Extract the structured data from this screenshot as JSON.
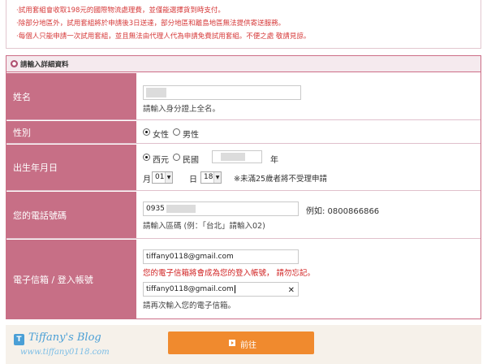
{
  "notice": {
    "lines": [
      "·試用套組會收取198元的國際物流處理費，並僅能選擇貨到時支付。",
      "·除部分地區外，試用套組將於申請後3日送達，部分地區和離島地區無法提供寄送服務。",
      "·每個人只能申請一次試用套組，並且無法由代理人代為申請免費試用套組。不便之處 敬請見諒。"
    ]
  },
  "section": {
    "title": "請輸入詳細資料"
  },
  "name_row": {
    "label": "姓名",
    "hint": "請輸入身分證上全名。"
  },
  "gender_row": {
    "label": "性別",
    "options": [
      "女性",
      "男性"
    ],
    "selected": "女性"
  },
  "birth_row": {
    "label": "出生年月日",
    "era_options": [
      "西元",
      "民國"
    ],
    "era_selected": "西元",
    "year_unit": "年",
    "month_label": "月",
    "month_value": "01",
    "day_label": "日",
    "day_value": "18",
    "age_note": "※未滿25歲者將不受理申請"
  },
  "phone_row": {
    "label": "您的電話號碼",
    "value_prefix": "0935",
    "example_label": "例如: 0800866866",
    "hint": "請輸入區碼 (例：「台北」請輸入02)"
  },
  "email_row": {
    "label": "電子信箱 / 登入帳號",
    "email_value": "tiffany0118@gmail.com",
    "warning": "您的電子信箱將會成為您的登入帳號，  請勿忘記。",
    "confirm_value": "tiffany0118@gmail.com",
    "confirm_hint": "請再次輸入您的電子信箱。"
  },
  "footer": {
    "watermark_title": "Tiffany's Blog",
    "watermark_url": "www.tiffany0118.com",
    "next_label": "前往"
  },
  "colors": {
    "label_bg": "#c76f86",
    "border": "#cc6e87",
    "notice_red": "#d63a3a",
    "button": "#f08a2e"
  }
}
